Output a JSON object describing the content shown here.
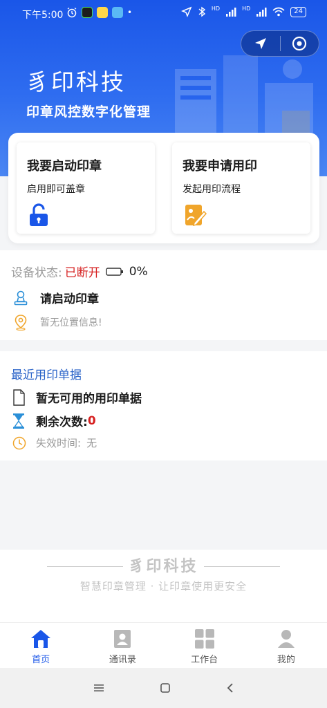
{
  "status_bar": {
    "time": "下午5:00",
    "signal_label_1": "HD",
    "signal_label_2": "HD",
    "battery": "24"
  },
  "hero": {
    "title": "豸印科技",
    "subtitle": "印章风控数字化管理"
  },
  "cards": [
    {
      "title": "我要启动印章",
      "desc": "启用即可盖章",
      "icon": "unlock-icon"
    },
    {
      "title": "我要申请用印",
      "desc": "发起用印流程",
      "icon": "edit-document-icon"
    }
  ],
  "device": {
    "status_label": "设备状态:",
    "status_value": "已断开",
    "battery_percent": "0%",
    "action_text": "请启动印章",
    "location_text": "暂无位置信息!"
  },
  "records": {
    "title": "最近用印单据",
    "empty_text": "暂无可用的用印单据",
    "remaining_label": "剩余次数:",
    "remaining_value": "0",
    "expire_label": "失效时间:",
    "expire_value": "无"
  },
  "footer_brand": {
    "title": "豸印科技",
    "slogan": "智慧印章管理 · 让印章使用更安全"
  },
  "tabbar": [
    {
      "label": "首页",
      "icon": "home-icon",
      "active": true
    },
    {
      "label": "通讯录",
      "icon": "contacts-icon",
      "active": false
    },
    {
      "label": "工作台",
      "icon": "workbench-icon",
      "active": false
    },
    {
      "label": "我的",
      "icon": "profile-icon",
      "active": false
    }
  ],
  "colors": {
    "brand_blue": "#1a56e8",
    "danger_red": "#d62020",
    "link_blue": "#2a63c8",
    "icon_orange": "#f0a52b"
  }
}
